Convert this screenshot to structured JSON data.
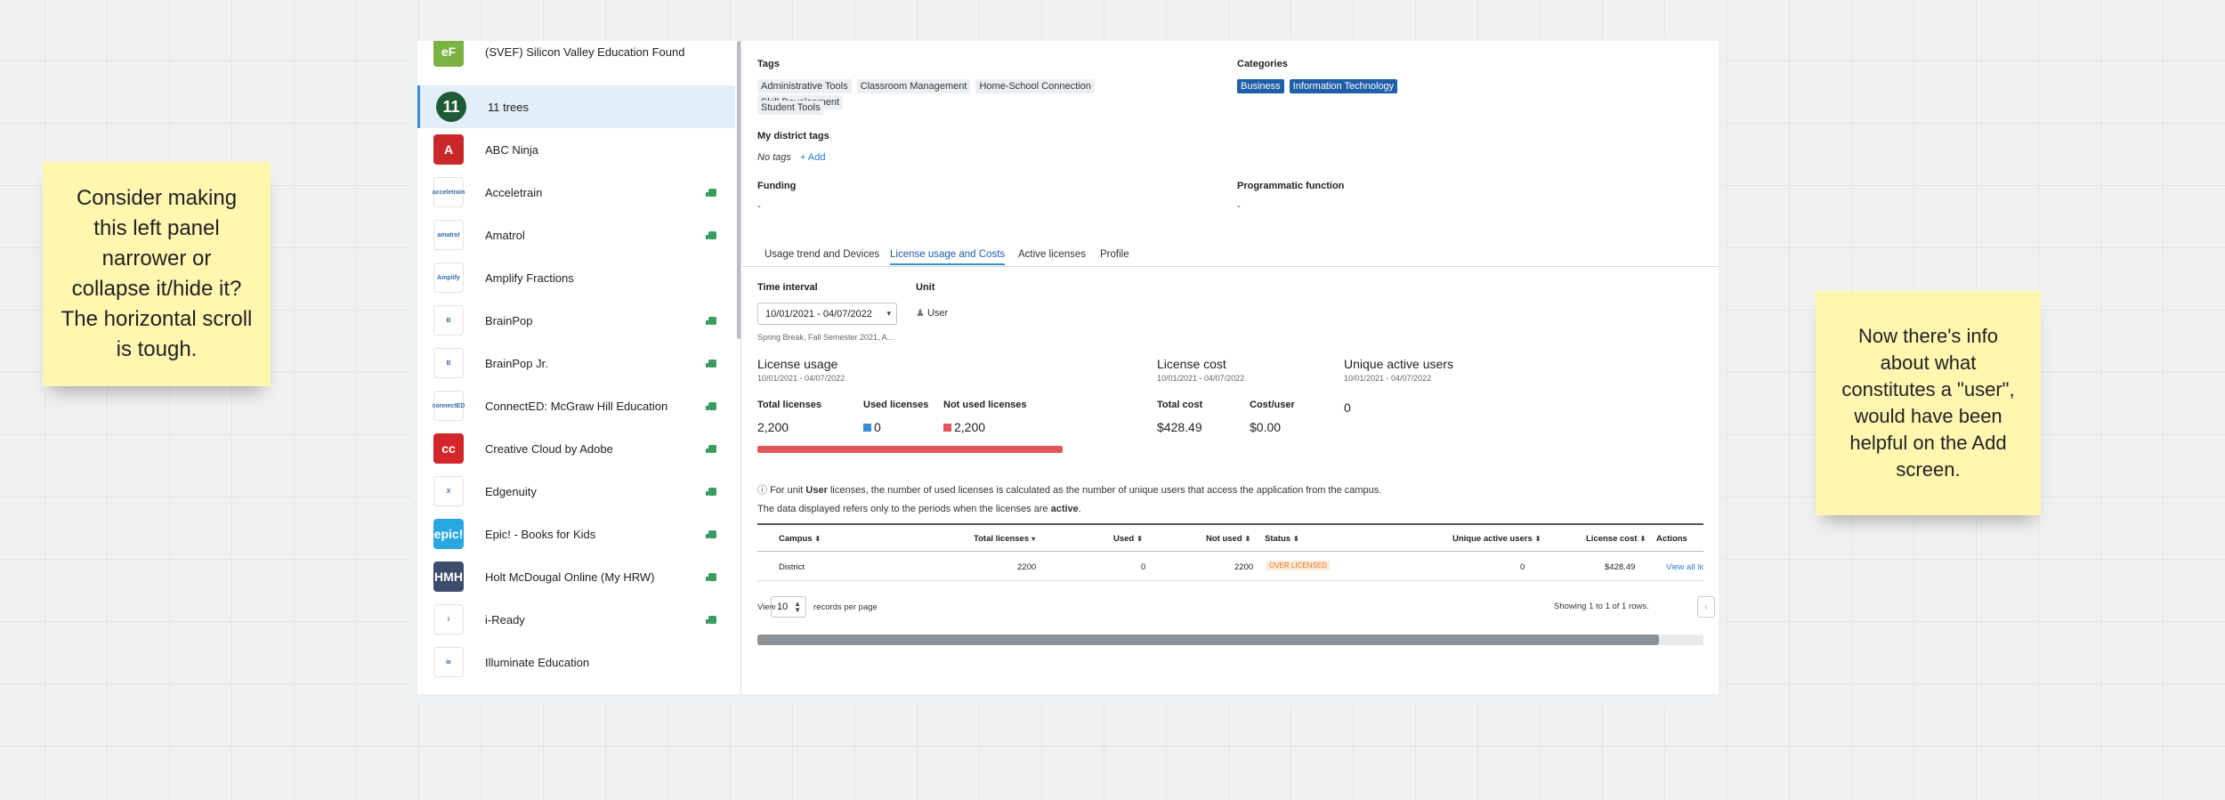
{
  "sticky_left": "Consider making this left panel narrower or collapse it/hide it? The horizontal scroll is tough.",
  "sticky_right": "Now there's info about what constitutes a \"user\", would have been helpful on the Add screen.",
  "apps": [
    {
      "name": "(SVEF) Silicon Valley Education Found",
      "logo_text": "eF",
      "logo_color": "#7bb241",
      "flag": false
    },
    {
      "name": "11 trees",
      "logo_text": "11",
      "logo_color": "#1e5a35",
      "flag": false,
      "selected": true
    },
    {
      "name": "ABC Ninja",
      "logo_text": "A",
      "logo_color": "#c8282a",
      "flag": false
    },
    {
      "name": "Acceletrain",
      "logo_text": "acceletrain",
      "logo_color": "#ffffff",
      "flag": true
    },
    {
      "name": "Amatrol",
      "logo_text": "amatrol",
      "logo_color": "#ffffff",
      "flag": true
    },
    {
      "name": "Amplify Fractions",
      "logo_text": "Amplify",
      "logo_color": "#ffffff",
      "flag": false
    },
    {
      "name": "BrainPop",
      "logo_text": "B",
      "logo_color": "#ffffff",
      "flag": true
    },
    {
      "name": "BrainPop Jr.",
      "logo_text": "B",
      "logo_color": "#ffffff",
      "flag": true
    },
    {
      "name": "ConnectED: McGraw Hill Education",
      "logo_text": "connectED",
      "logo_color": "#ffffff",
      "flag": true
    },
    {
      "name": "Creative Cloud by Adobe",
      "logo_text": "cc",
      "logo_color": "#d4252b",
      "flag": true
    },
    {
      "name": "Edgenuity",
      "logo_text": "X",
      "logo_color": "#ffffff",
      "flag": true
    },
    {
      "name": "Epic! - Books for Kids",
      "logo_text": "epic!",
      "logo_color": "#29a8e0",
      "flag": true
    },
    {
      "name": "Holt McDougal Online (My HRW)",
      "logo_text": "HMH",
      "logo_color": "#3c4c6a",
      "flag": true
    },
    {
      "name": "i-Ready",
      "logo_text": "i",
      "logo_color": "#ffffff",
      "flag": true
    },
    {
      "name": "Illuminate Education",
      "logo_text": "ie",
      "logo_color": "#ffffff",
      "flag": false
    }
  ],
  "details": {
    "tags_label": "Tags",
    "tags": [
      "Administrative Tools",
      "Classroom Management",
      "Home-School Connection",
      "Skill Development",
      "Student Tools"
    ],
    "categories_label": "Categories",
    "categories": [
      "Business",
      "Information Technology"
    ],
    "district_tags_label": "My district tags",
    "no_tags": "No tags",
    "add_label": "+ Add",
    "funding_label": "Funding",
    "funding_value": "-",
    "programmatic_label": "Programmatic function",
    "programmatic_value": "-"
  },
  "tabs": [
    "Usage trend and Devices",
    "License usage and Costs",
    "Active licenses",
    "Profile"
  ],
  "active_tab": "License usage and Costs",
  "controls": {
    "time_interval_label": "Time interval",
    "time_interval_value": "10/01/2021 - 04/07/2022",
    "time_interval_note": "Spring Break, Fall Semester 2021, A...",
    "unit_label": "Unit",
    "unit_value": "User"
  },
  "license_usage": {
    "title": "License usage",
    "range": "10/01/2021 - 04/07/2022",
    "total_label": "Total licenses",
    "total_value": "2,200",
    "used_label": "Used licenses",
    "used_value": "0",
    "not_used_label": "Not used licenses",
    "not_used_value": "2,200",
    "used_fraction": 0,
    "used_color": "#3a8ed4",
    "not_used_color": "#e0555a"
  },
  "license_cost": {
    "title": "License cost",
    "range": "10/01/2021 - 04/07/2022",
    "total_cost_label": "Total cost",
    "total_cost_value": "$428.49",
    "cost_user_label": "Cost/user",
    "cost_user_value": "$0.00"
  },
  "unique_users": {
    "title": "Unique active users",
    "range": "10/01/2021 - 04/07/2022",
    "value": "0"
  },
  "info": {
    "line1_pre": "For unit ",
    "line1_bold": "User",
    "line1_post": " licenses, the number of used licenses is calculated as the number of unique users that access the application from the campus.",
    "line2_pre": "The data displayed refers only to the periods when the licenses are ",
    "line2_bold": "active",
    "line2_post": "."
  },
  "table": {
    "headers": {
      "campus": "Campus",
      "total": "Total licenses",
      "used": "Used",
      "not_used": "Not used",
      "status": "Status",
      "unique": "Unique active users",
      "cost": "License cost",
      "actions": "Actions"
    },
    "row": {
      "campus": "District",
      "total": "2200",
      "used": "0",
      "not_used": "2200",
      "status": "OVER LICENSED",
      "unique": "0",
      "cost": "$428.49",
      "action": "View all lic"
    }
  },
  "pager": {
    "view_label": "View",
    "per_page": "10",
    "per_page_label": "records per page",
    "showing": "Showing 1 to 1 of 1 rows.",
    "prev": "‹"
  }
}
